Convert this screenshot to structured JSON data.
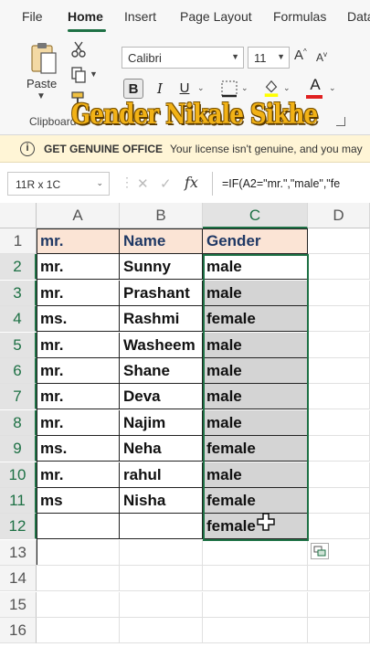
{
  "ribbon": {
    "tabs": [
      {
        "label": "File"
      },
      {
        "label": "Home"
      },
      {
        "label": "Insert"
      },
      {
        "label": "Page Layout"
      },
      {
        "label": "Formulas"
      },
      {
        "label": "Data"
      }
    ],
    "paste_label": "Paste",
    "clipboard_label": "Clipboard",
    "font_name": "Calibri",
    "font_size": "11",
    "bold": "B",
    "italic": "I",
    "underline": "U",
    "font_color_letter": "A",
    "accent_color": "#1e7145"
  },
  "overlay_title": "Gender Nikale Sikhe",
  "license_bar": {
    "title": "GET GENUINE OFFICE",
    "message": "Your license isn't genuine, and you may"
  },
  "formula_bar": {
    "name_box": "11R x 1C",
    "fx": "fx",
    "formula": "=IF(A2=\"mr.\",\"male\",\"fe"
  },
  "sheet": {
    "columns": [
      "A",
      "B",
      "C",
      "D"
    ],
    "row_numbers": [
      "1",
      "2",
      "3",
      "4",
      "5",
      "6",
      "7",
      "8",
      "9",
      "10",
      "11",
      "12",
      "13",
      "14",
      "15",
      "16"
    ],
    "header_row": [
      "mr.",
      "Name",
      "Gender"
    ],
    "rows": [
      [
        "mr.",
        "Sunny",
        "male"
      ],
      [
        "mr.",
        "Prashant",
        "male"
      ],
      [
        "ms.",
        "Rashmi",
        "female"
      ],
      [
        "mr.",
        "Washeem",
        "male"
      ],
      [
        "mr.",
        "Shane",
        "male"
      ],
      [
        "mr.",
        "Deva",
        "male"
      ],
      [
        "mr.",
        "Najim",
        "male"
      ],
      [
        "ms.",
        "Neha",
        "female"
      ],
      [
        "mr.",
        "rahul",
        "male"
      ],
      [
        "ms",
        "Nisha",
        "female"
      ],
      [
        "",
        "",
        "female"
      ]
    ]
  }
}
